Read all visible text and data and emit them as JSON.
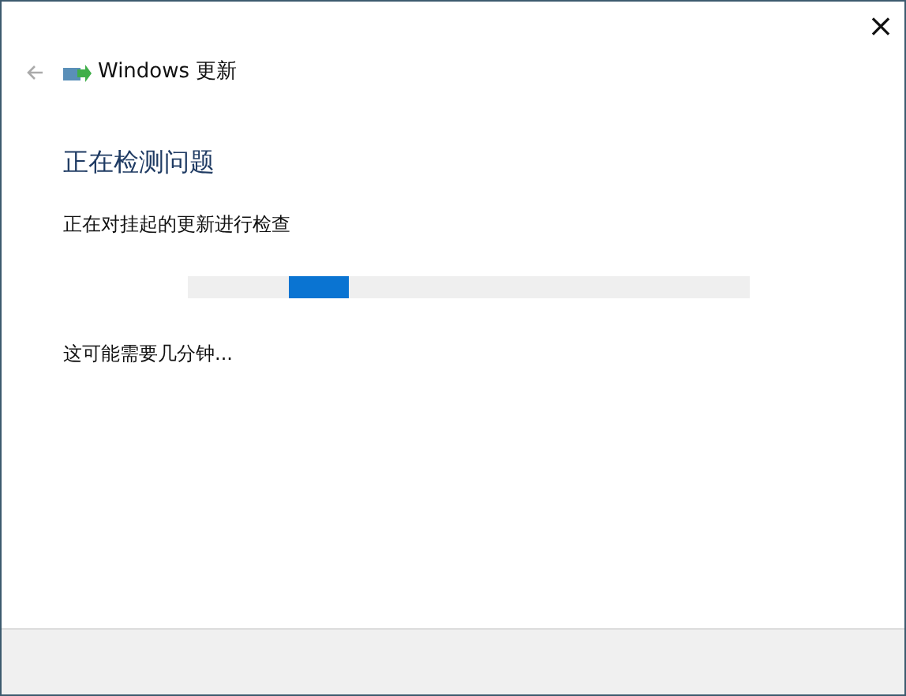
{
  "window": {
    "close_button": "×"
  },
  "header": {
    "title": "Windows 更新"
  },
  "heading": "正在检测问题",
  "status": "正在对挂起的更新进行检查",
  "progress": {
    "indeterminate": true
  },
  "note": "这可能需要几分钟..."
}
